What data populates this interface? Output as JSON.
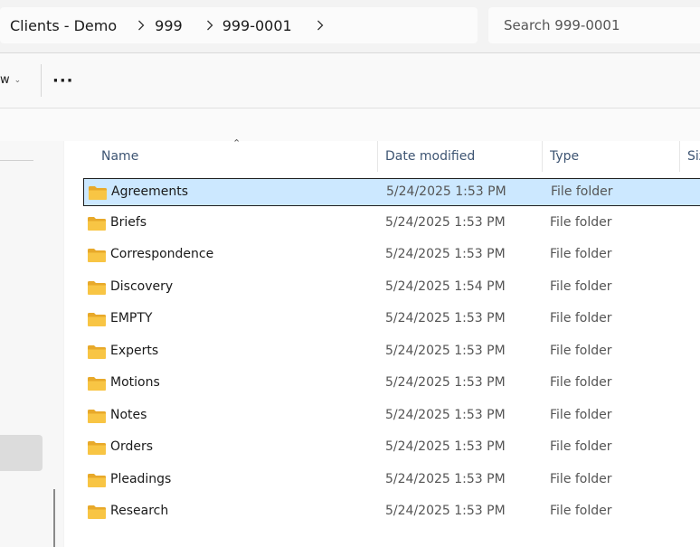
{
  "address": {
    "crumbs": [
      "Clients - Demo",
      "999",
      "999-0001"
    ]
  },
  "search": {
    "placeholder": "Search 999-0001"
  },
  "toolbar": {
    "view_label": "w",
    "more_label": "···"
  },
  "columns": {
    "name": "Name",
    "date": "Date modified",
    "type": "Type",
    "size": "Size"
  },
  "files": [
    {
      "name": "Agreements",
      "date": "5/24/2025 1:53 PM",
      "type": "File folder",
      "selected": true
    },
    {
      "name": "Briefs",
      "date": "5/24/2025 1:53 PM",
      "type": "File folder"
    },
    {
      "name": "Correspondence",
      "date": "5/24/2025 1:53 PM",
      "type": "File folder"
    },
    {
      "name": "Discovery",
      "date": "5/24/2025 1:54 PM",
      "type": "File folder"
    },
    {
      "name": "EMPTY",
      "date": "5/24/2025 1:53 PM",
      "type": "File folder"
    },
    {
      "name": "Experts",
      "date": "5/24/2025 1:53 PM",
      "type": "File folder"
    },
    {
      "name": "Motions",
      "date": "5/24/2025 1:53 PM",
      "type": "File folder"
    },
    {
      "name": "Notes",
      "date": "5/24/2025 1:53 PM",
      "type": "File folder"
    },
    {
      "name": "Orders",
      "date": "5/24/2025 1:53 PM",
      "type": "File folder"
    },
    {
      "name": "Pleadings",
      "date": "5/24/2025 1:53 PM",
      "type": "File folder"
    },
    {
      "name": "Research",
      "date": "5/24/2025 1:53 PM",
      "type": "File folder"
    }
  ],
  "colors": {
    "selection": "#cce8ff",
    "folder": "#f8c544",
    "header_text": "#3e5573"
  },
  "icons": {
    "folder": "folder-icon",
    "chevron": "chevron-right-icon",
    "sort": "sort-up-icon"
  }
}
